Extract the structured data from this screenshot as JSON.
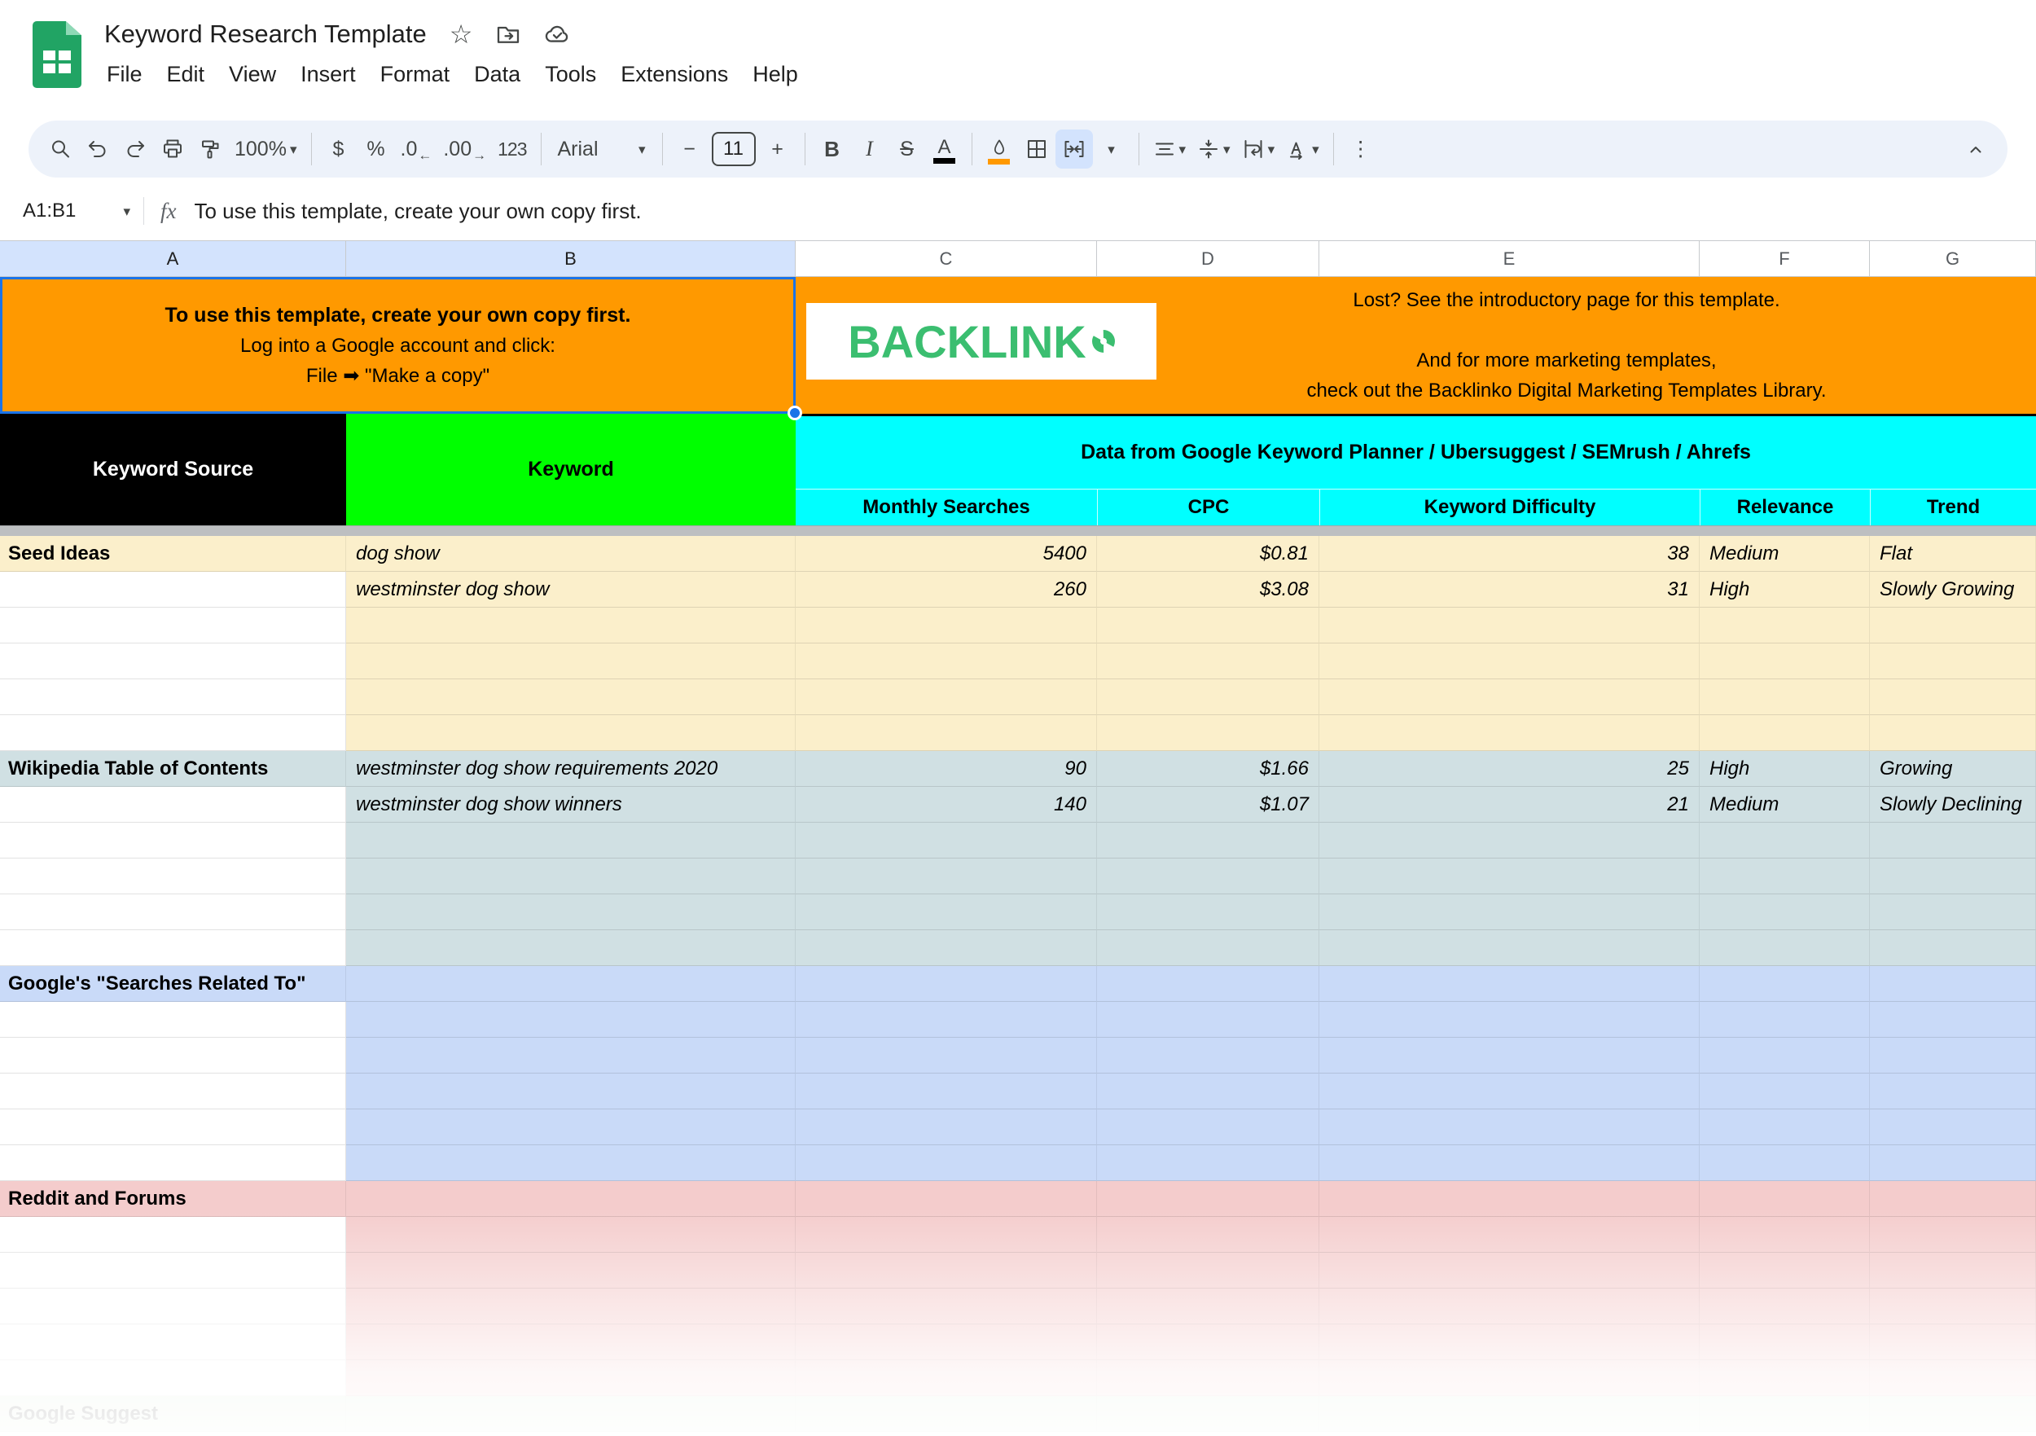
{
  "window": {
    "doc_title": "Keyword Research Template",
    "menu_items": [
      "File",
      "Edit",
      "View",
      "Insert",
      "Format",
      "Data",
      "Tools",
      "Extensions",
      "Help"
    ]
  },
  "icons": {
    "star": "☆",
    "more_vertical": "⋮",
    "dropdown_arrow": "▾",
    "decimal_decrease_arrow": "←",
    "decimal_increase_arrow": "→"
  },
  "toolbar": {
    "zoom_value": "100%",
    "currency_label": "$",
    "percent_label": "%",
    "decimal_decrease_label": ".0",
    "decimal_increase_label": ".00",
    "number_format_label": "123",
    "font_family_value": "Arial",
    "decrease_font_label": "−",
    "font_size_value": "11",
    "increase_font_label": "+",
    "bold_label": "B",
    "italic_label": "I",
    "strikethrough_label": "S",
    "text_color_label": "A"
  },
  "formula_bar": {
    "name_box_value": "A1:B1",
    "fx_label": "fx",
    "formula_text": "To use this template, create your own copy first."
  },
  "column_headers": [
    "A",
    "B",
    "C",
    "D",
    "E",
    "F",
    "G"
  ],
  "selection": {
    "range": "A1:B1",
    "highlighted_columns": [
      "A",
      "B"
    ]
  },
  "banner": {
    "left_line1": "To use this template, create your own copy first.",
    "left_line2": "Log into a Google account and click:",
    "left_line3": "File ➡ \"Make a copy\"",
    "logo_text": "BACKLINKO",
    "right_line1": "Lost? See the introductory page for this template.",
    "right_line2": "And for more marketing templates,",
    "right_line3": "check out the Backlinko Digital Marketing Templates Library."
  },
  "sheet": {
    "keyword_source_header": "Keyword Source",
    "keyword_header": "Keyword",
    "data_source_header": "Data from Google Keyword Planner / Ubersuggest / SEMrush / Ahrefs",
    "sub_headers": [
      "Monthly Searches",
      "CPC",
      "Keyword Difficulty",
      "Relevance",
      "Trend"
    ],
    "sections": [
      {
        "label": "Seed Ideas",
        "fill": "#FBEFCB",
        "rows": [
          {
            "keyword": "dog show",
            "monthly_searches": "5400",
            "cpc": "$0.81",
            "keyword_difficulty": "38",
            "relevance": "Medium",
            "trend": "Flat"
          },
          {
            "keyword": "westminster dog show",
            "monthly_searches": "260",
            "cpc": "$3.08",
            "keyword_difficulty": "31",
            "relevance": "High",
            "trend": "Slowly Growing"
          },
          {},
          {},
          {},
          {}
        ]
      },
      {
        "label": "Wikipedia Table of Contents",
        "fill": "#D0E0E3",
        "rows": [
          {
            "keyword": "westminster dog show requirements 2020",
            "monthly_searches": "90",
            "cpc": "$1.66",
            "keyword_difficulty": "25",
            "relevance": "High",
            "trend": "Growing"
          },
          {
            "keyword": "westminster dog show winners",
            "monthly_searches": "140",
            "cpc": "$1.07",
            "keyword_difficulty": "21",
            "relevance": "Medium",
            "trend": "Slowly Declining"
          },
          {},
          {},
          {},
          {}
        ]
      },
      {
        "label": "Google's \"Searches Related To\"",
        "fill": "#C9DAF8",
        "rows": [
          {},
          {},
          {},
          {},
          {},
          {}
        ]
      },
      {
        "label": "Reddit and Forums",
        "fill": "#F4CCCC",
        "rows": [
          {},
          {},
          {},
          {},
          {},
          {}
        ]
      },
      {
        "label": "Google Suggest",
        "fill": "#D9EAD3",
        "rows": [
          {}
        ]
      }
    ]
  },
  "colors": {
    "accent": "#1A73E8",
    "orange": "#FF9900",
    "bright_green": "#00FF00",
    "cyan": "#00FFFF",
    "selected_header": "#D3E3FD",
    "toolbar_bg": "#EDF2FA",
    "icon": "#444746",
    "logo_green": "#3BBE70",
    "sheets_green": "#21A464"
  }
}
